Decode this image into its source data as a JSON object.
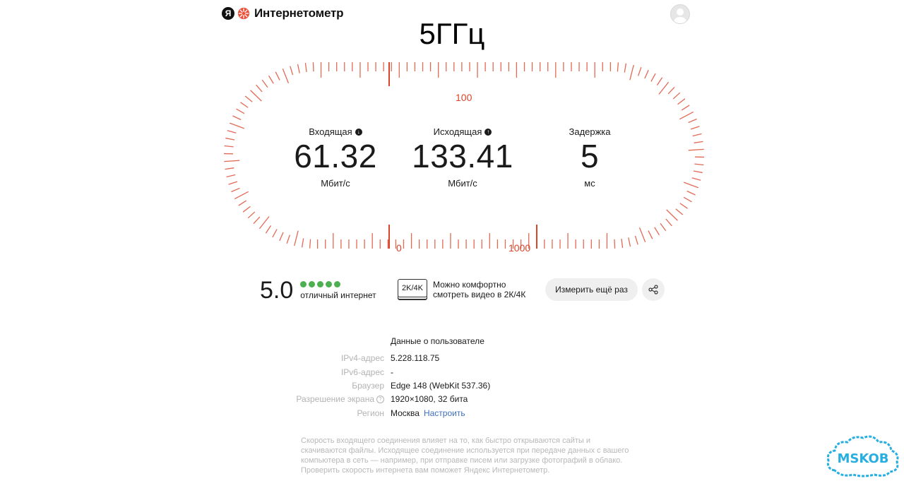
{
  "header": {
    "logo_letter": "Я",
    "logo_text": "Интернетометр",
    "overlay_title": "5ГГц"
  },
  "gauge": {
    "label_100": "100",
    "label_0": "0",
    "label_1000": "1000",
    "accent_color": "#d9452b"
  },
  "metrics": {
    "download": {
      "label": "Входящая",
      "value": "61.32",
      "unit": "Мбит/с",
      "icon": "download-arrow-icon"
    },
    "upload": {
      "label": "Исходящая",
      "value": "133.41",
      "unit": "Мбит/с",
      "icon": "upload-arrow-icon"
    },
    "latency": {
      "label": "Задержка",
      "value": "5",
      "unit": "мс"
    }
  },
  "score": {
    "value": "5.0",
    "stars_filled": 5,
    "stars_total": 5,
    "star_color": "#4caf50",
    "text": "отличный интернет"
  },
  "video": {
    "badge": "2K/4K",
    "line1": "Можно комфортно",
    "line2": "смотреть видео в 2К/4К"
  },
  "actions": {
    "measure_again": "Измерить ещё раз",
    "share_icon": "share-icon"
  },
  "user_info": {
    "title": "Данные о пользователе",
    "rows": [
      {
        "key": "IPv4-адрес",
        "value": "5.228.118.75"
      },
      {
        "key": "IPv6-адрес",
        "value": "-"
      },
      {
        "key": "Браузер",
        "value": "Edge 148 (WebKit 537.36)"
      },
      {
        "key": "Разрешение экрана",
        "value": "1920×1080, 32 бита"
      },
      {
        "key": "Регион",
        "value": "Москва",
        "link": "Настроить"
      }
    ]
  },
  "footer": {
    "text": "Скорость входящего соединения влияет на то, как быстро открываются сайты и скачиваются файлы. Исходящее соединение используется при передаче данных с вашего компьютера в сеть — например, при отправке писем или загрузке фотографий в облако. Проверить скорость интернета вам поможет Яндекс Интернетометр."
  },
  "watermark": {
    "text": "MSKOB",
    "color": "#29aee0"
  }
}
